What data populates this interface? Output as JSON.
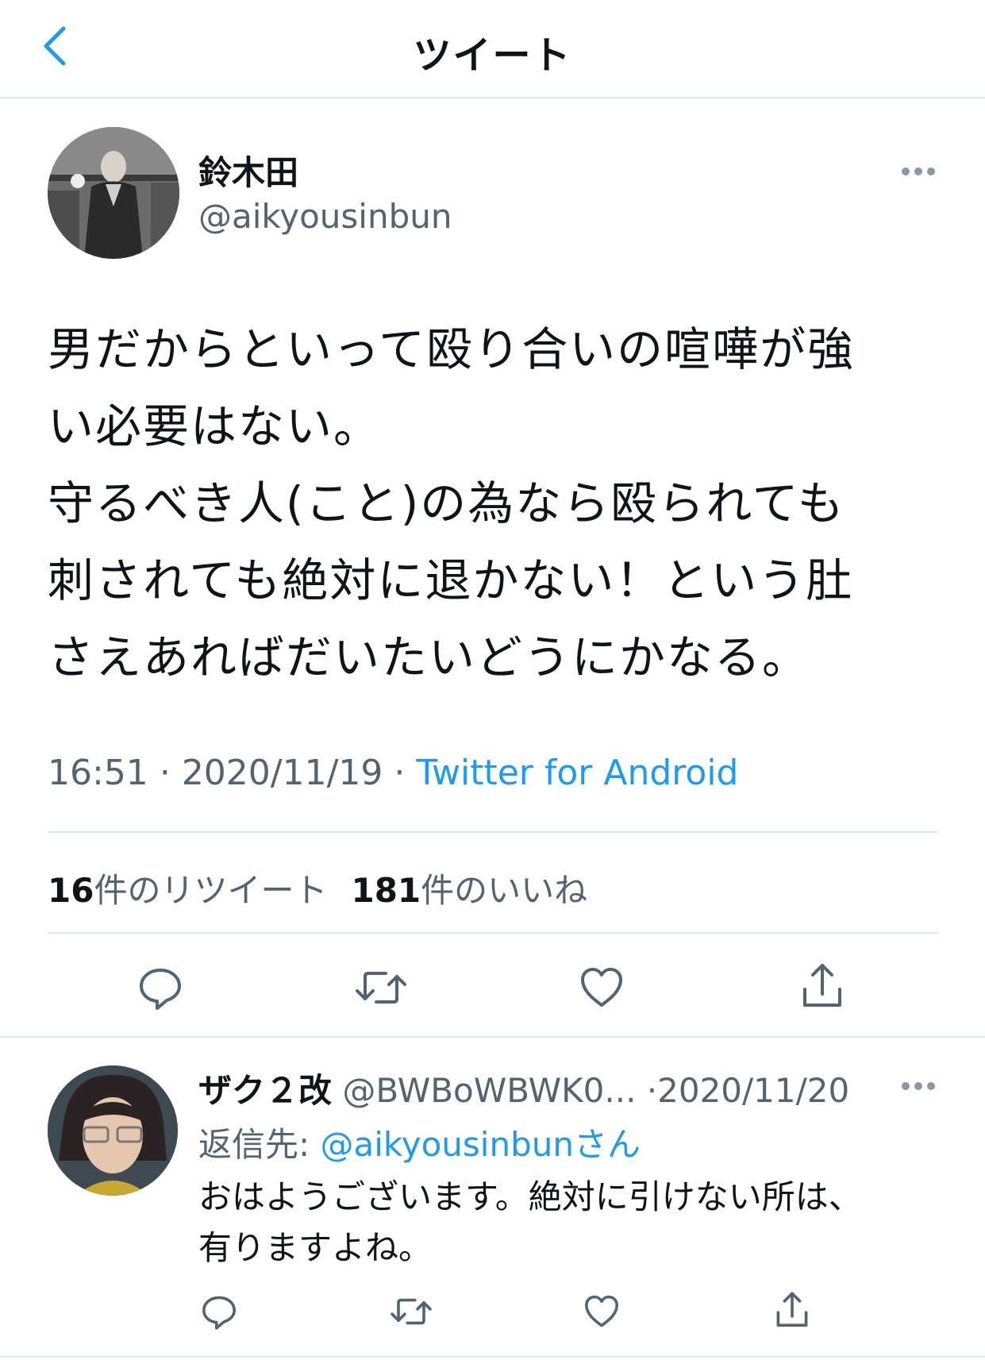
{
  "header": {
    "title": "ツイート",
    "back_icon": "chevron-left-icon"
  },
  "tweet": {
    "author": {
      "display_name": "鈴木田",
      "handle": "@aikyousinbun"
    },
    "text_lines": [
      "男だからといって殴り合いの喧嘩が強",
      "い必要はない。",
      "守るべき人(こと)の為なら殴られても",
      "刺されても絶対に退かない！という肚",
      "さえあればだいたいどうにかなる。"
    ],
    "time": "16:51",
    "date": "2020/11/19",
    "separator": "·",
    "source": "Twitter for Android",
    "retweets": {
      "count": "16",
      "label": "件のリツイート"
    },
    "likes": {
      "count": "181",
      "label": "件のいいね"
    }
  },
  "reply": {
    "author": {
      "display_name": "ザク２改",
      "handle": "@BWBoWBWK0...",
      "date": "2020/11/20"
    },
    "reply_to_label": "返信先: ",
    "reply_to_handle": "@aikyousinbunさん",
    "text_lines": [
      "おはようございます。絶対に引けない所は、",
      "有りますよね。"
    ]
  },
  "colors": {
    "accent": "#1d9bf0",
    "secondary_text": "#536471",
    "divider": "#e1e6ea",
    "icon": "#536471"
  }
}
